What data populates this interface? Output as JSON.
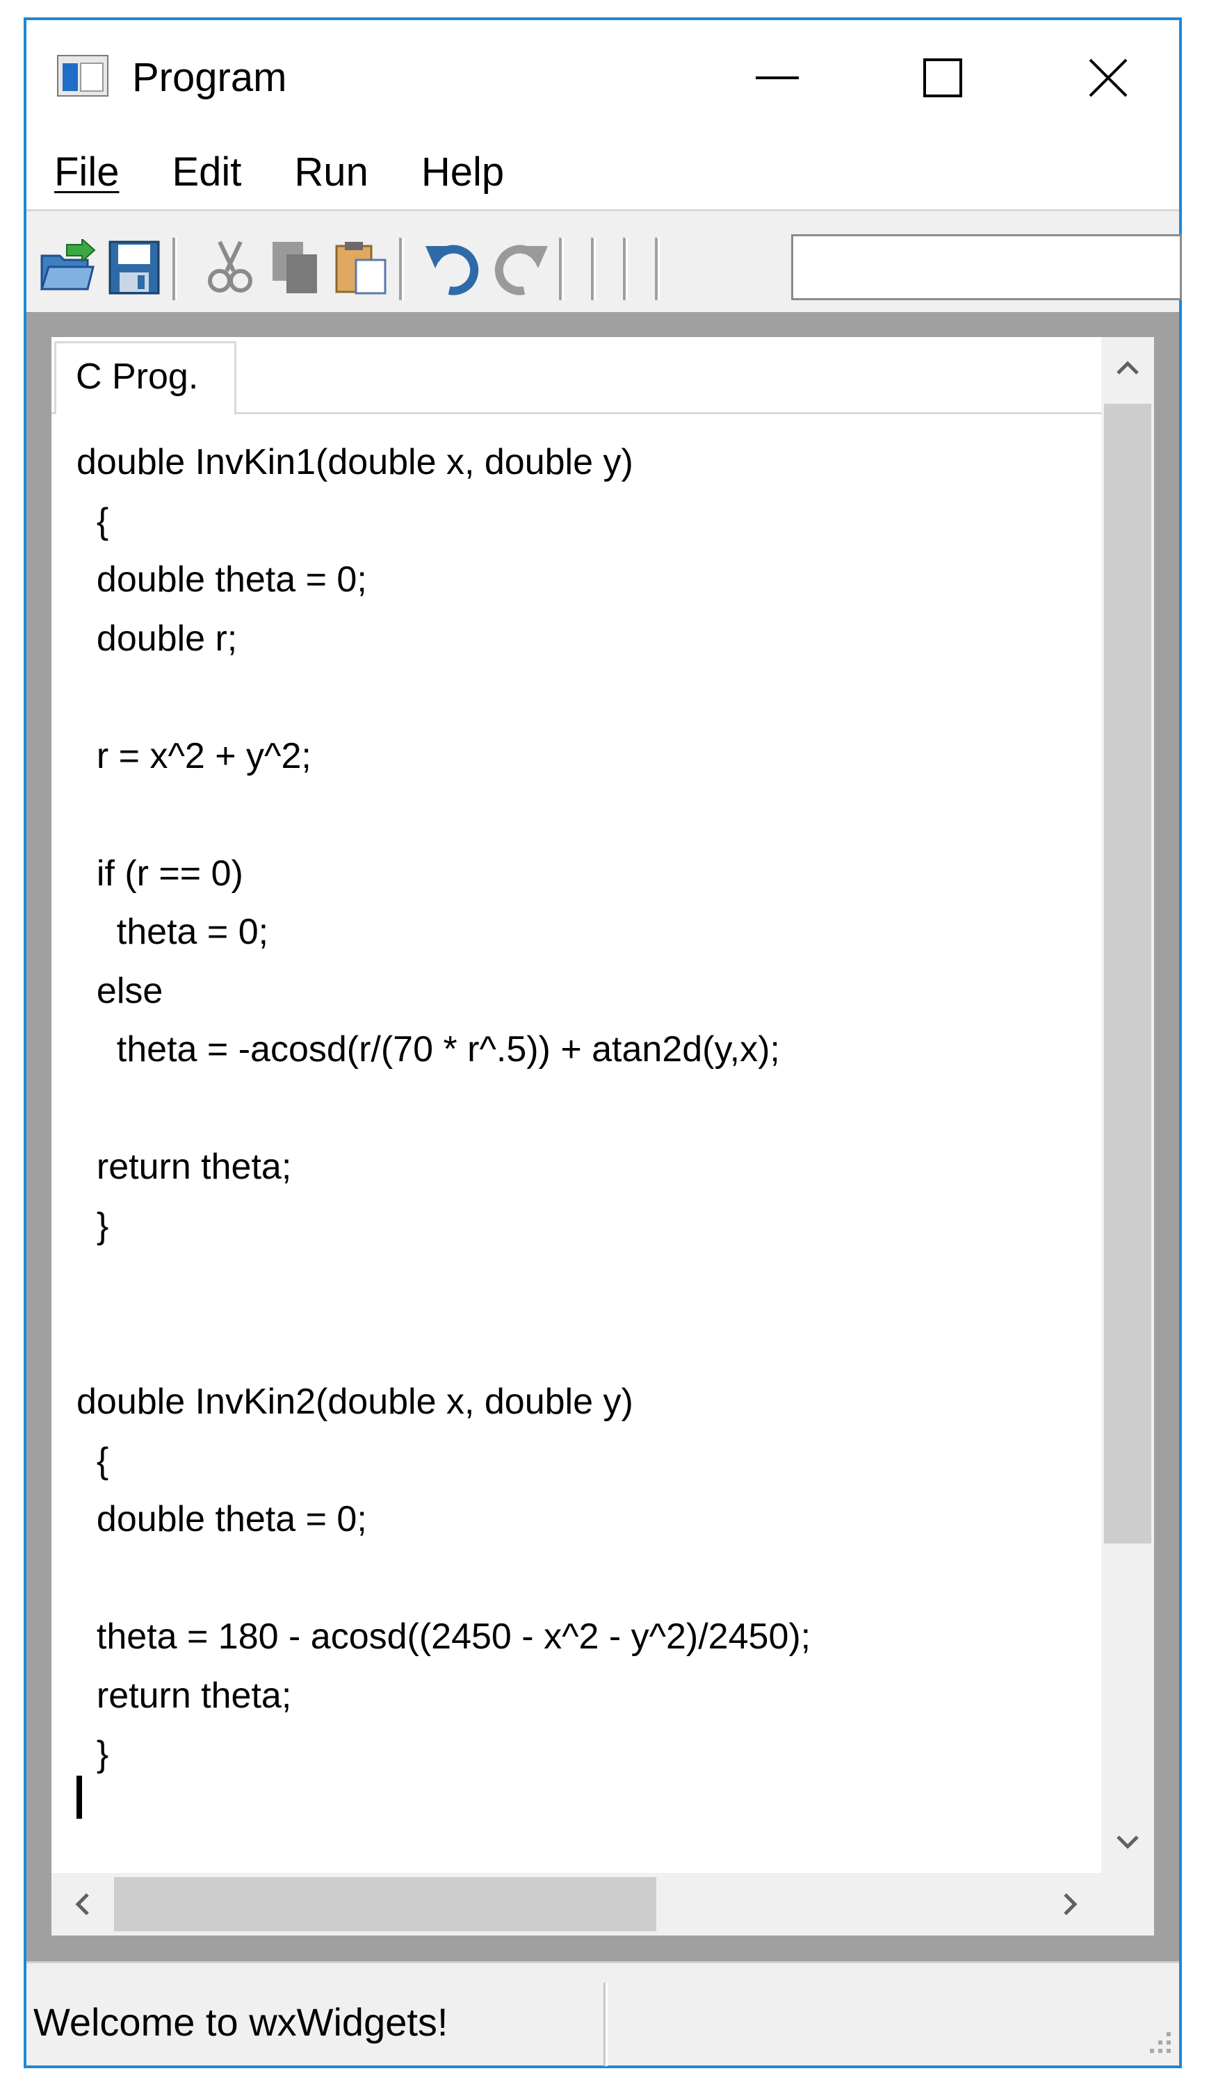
{
  "window": {
    "title": "Program"
  },
  "menu": {
    "items": [
      "File",
      "Edit",
      "Run",
      "Help"
    ]
  },
  "toolbar": {
    "buttons": [
      "open-icon",
      "save-icon",
      "cut-icon",
      "copy-icon",
      "paste-icon",
      "undo-icon",
      "redo-icon"
    ],
    "search_value": ""
  },
  "editor": {
    "tab_label": "C Prog.",
    "code": "double InvKin1(double x, double y)\n  {\n  double theta = 0;\n  double r;\n\n  r = x^2 + y^2;\n\n  if (r == 0)\n    theta = 0;\n  else\n    theta = -acosd(r/(70 * r^.5)) + atan2d(y,x);\n\n  return theta;\n  }\n\n\ndouble InvKin2(double x, double y)\n  {\n  double theta = 0;\n\n  theta = 180 - acosd((2450 - x^2 - y^2)/2450);\n  return theta;\n  }"
  },
  "status": {
    "text": "Welcome to wxWidgets!"
  },
  "colors": {
    "window_border": "#1e88d8",
    "chrome": "#f0f0f0",
    "editor_frame": "#a0a0a0"
  }
}
